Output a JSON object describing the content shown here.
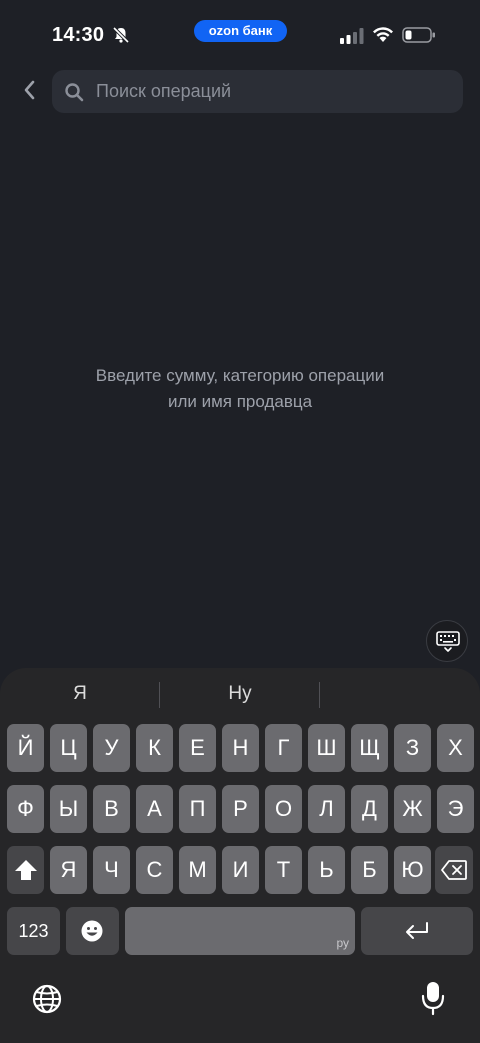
{
  "status_bar": {
    "time": "14:30",
    "bell_icon": "bell-muted-icon",
    "brand": "ozon банк",
    "brand_color": "#1164f4",
    "signal_icon": "cellular-signal-icon",
    "wifi_icon": "wifi-icon",
    "battery_icon": "battery-low-icon"
  },
  "header": {
    "back_icon": "chevron-left-icon",
    "search": {
      "icon": "search-icon",
      "placeholder": "Поиск операций",
      "value": ""
    }
  },
  "empty_state": {
    "line1": "Введите сумму, категорию операции",
    "line2": "или имя продавца"
  },
  "keyboard_toggle_icon": "keyboard-dismiss-icon",
  "keyboard": {
    "suggestions": [
      "Я",
      "Ну",
      ""
    ],
    "row1": [
      "Й",
      "Ц",
      "У",
      "К",
      "Е",
      "Н",
      "Г",
      "Ш",
      "Щ",
      "З",
      "Х"
    ],
    "row2": [
      "Ф",
      "Ы",
      "В",
      "А",
      "П",
      "Р",
      "О",
      "Л",
      "Д",
      "Ж",
      "Э"
    ],
    "row3": [
      "Я",
      "Ч",
      "С",
      "М",
      "И",
      "Т",
      "Ь",
      "Б",
      "Ю"
    ],
    "shift_icon": "shift-icon",
    "backspace_icon": "backspace-icon",
    "numbers_label": "123",
    "emoji_icon": "emoji-icon",
    "space_label": "ру",
    "return_icon": "return-icon",
    "globe_icon": "globe-icon",
    "mic_icon": "microphone-icon"
  }
}
